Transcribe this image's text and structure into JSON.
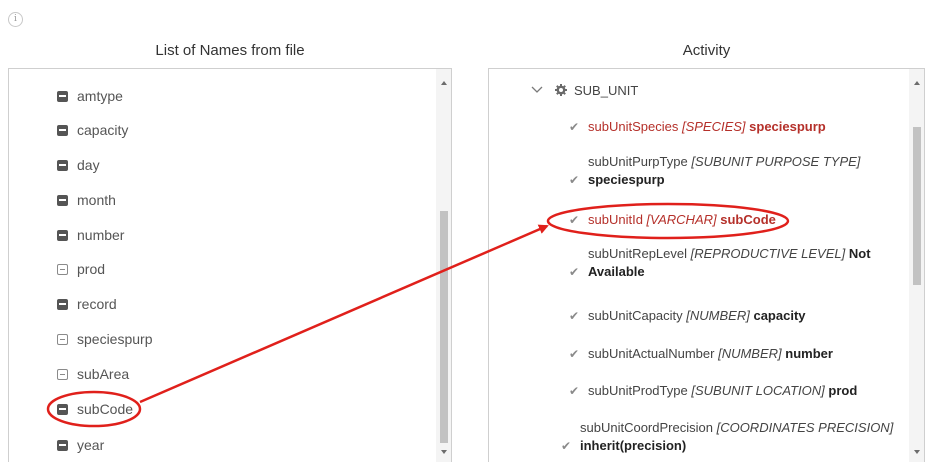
{
  "left_panel": {
    "title": "List of Names from file",
    "items": [
      {
        "label": "amtype",
        "icon": "filled-square-icon"
      },
      {
        "label": "capacity",
        "icon": "filled-square-icon"
      },
      {
        "label": "day",
        "icon": "filled-square-icon"
      },
      {
        "label": "month",
        "icon": "filled-square-icon"
      },
      {
        "label": "number",
        "icon": "filled-square-icon"
      },
      {
        "label": "prod",
        "icon": "outline-square-icon"
      },
      {
        "label": "record",
        "icon": "filled-square-icon"
      },
      {
        "label": "speciespurp",
        "icon": "outline-square-icon"
      },
      {
        "label": "subArea",
        "icon": "outline-square-icon"
      },
      {
        "label": "subCode",
        "icon": "filled-square-icon"
      },
      {
        "label": "year",
        "icon": "filled-square-icon"
      }
    ]
  },
  "right_panel": {
    "title": "Activity",
    "tree_root": "SUB_UNIT",
    "items": [
      {
        "name": "subUnitSpecies",
        "type": "[SPECIES]",
        "value": "speciespurp",
        "highlight": true
      },
      {
        "name": "subUnitPurpType",
        "type": "[SUBUNIT PURPOSE TYPE]",
        "value": "speciespurp",
        "highlight": false
      },
      {
        "name": "subUnitId",
        "type": "[VARCHAR]",
        "value": "subCode",
        "highlight": true
      },
      {
        "name": "subUnitRepLevel",
        "type": "[REPRODUCTIVE LEVEL]",
        "value": "Not Available",
        "highlight": false
      },
      {
        "name": "subUnitCapacity",
        "type": "[NUMBER]",
        "value": "capacity",
        "highlight": false
      },
      {
        "name": "subUnitActualNumber",
        "type": "[NUMBER]",
        "value": "number",
        "highlight": false
      },
      {
        "name": "subUnitProdType",
        "type": "[SUBUNIT LOCATION]",
        "value": "prod",
        "highlight": false
      },
      {
        "name": "subUnitCoordPrecision",
        "type": "[COORDINATES PRECISION]",
        "value": "inherit(precision)",
        "highlight": false
      }
    ]
  },
  "annotation": {
    "color": "#e0201b"
  }
}
